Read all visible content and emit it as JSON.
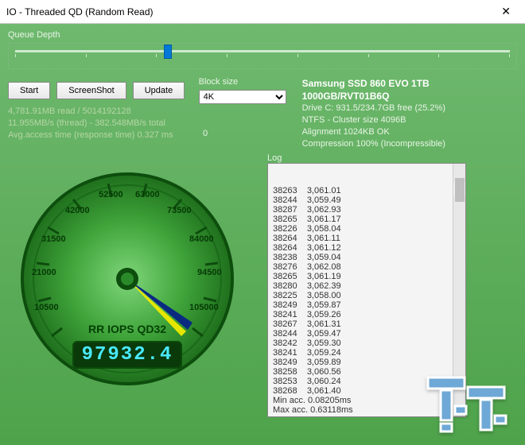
{
  "window": {
    "title": "IO - Threaded QD (Random Read)",
    "close": "✕"
  },
  "queue_depth_label": "Queue Depth",
  "buttons": {
    "start": "Start",
    "screenshot": "ScreenShot",
    "update": "Update"
  },
  "blocksize": {
    "label": "Block size",
    "value": "4K"
  },
  "drive": {
    "title": "Samsung SSD 860 EVO 1TB 1000GB/RVT01B6Q",
    "line1": "Drive C: 931.5/234.7GB free (25.2%)",
    "line2": "NTFS - Cluster size 4096B",
    "line3": "Alignment 1024KB OK",
    "line4": "Compression 100% (Incompressible)"
  },
  "stats": {
    "line1": "4,781.91MB read / 5014192128",
    "line2": "11.955MB/s (thread) - 382.548MB/s total",
    "line3": "Avg.access time (response time) 0.327 ms"
  },
  "zero": "0",
  "gauge": {
    "ticks": [
      "10500",
      "21000",
      "31500",
      "42000",
      "52500",
      "63000",
      "73500",
      "84000",
      "94500",
      "105000"
    ],
    "title": "RR IOPS QD32",
    "value": "97932.4"
  },
  "log_label": "Log",
  "log_lines": [
    "38263    3,061.01",
    "38244    3,059.49",
    "38287    3,062.93",
    "38265    3,061.17",
    "38226    3,058.04",
    "38264    3,061.11",
    "38264    3,061.12",
    "38238    3,059.04",
    "38276    3,062.08",
    "38265    3,061.19",
    "38280    3,062.39",
    "38225    3,058.00",
    "38249    3,059.87",
    "38241    3,059.26",
    "38267    3,061.31",
    "38244    3,059.47",
    "38242    3,059.30",
    "38241    3,059.24",
    "38249    3,059.89",
    "38258    3,060.56",
    "38253    3,060.24",
    "38268    3,061.40",
    "Min acc. 0.08205ms",
    "Max acc. 0.63118ms"
  ]
}
